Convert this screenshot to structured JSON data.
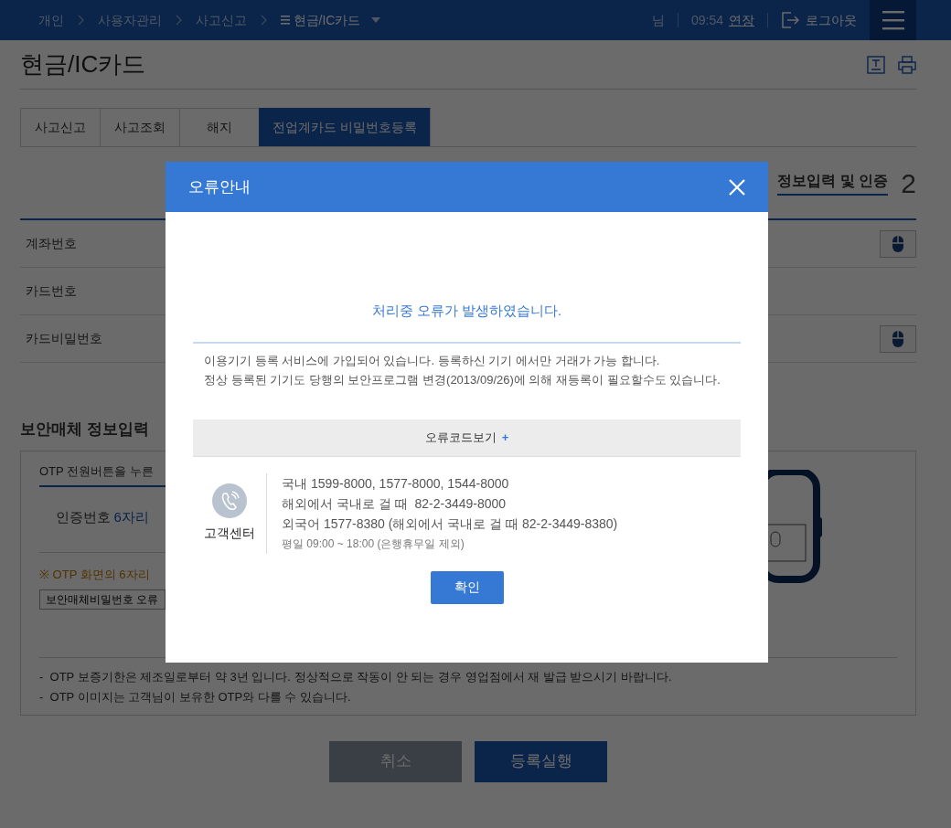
{
  "header": {
    "breadcrumbs": [
      "개인",
      "사용자관리",
      "사고신고"
    ],
    "current_menu": "현금/IC카드",
    "user_suffix": "님",
    "time": "09:54",
    "extend_link": "연장",
    "logout": "로그아웃"
  },
  "page_title": "현금/IC카드",
  "tabs": [
    {
      "label": "사고신고",
      "selected": false
    },
    {
      "label": "사고조회",
      "selected": false
    },
    {
      "label": "해지",
      "selected": false
    },
    {
      "label": "전업계카드 비밀번호등록",
      "selected": true
    }
  ],
  "step": {
    "title": "정보입력 및 인증",
    "number": "2"
  },
  "form_rows": [
    {
      "label": "계좌번호",
      "kind": "mouse-input"
    },
    {
      "label": "카드번호",
      "kind": "plain"
    },
    {
      "label": "카드비밀번호",
      "kind": "mouse-input"
    }
  ],
  "otp_section": {
    "title": "보안매체 정보입력",
    "tab": "OTP 전원버튼을 누른",
    "code_label": "인증번호",
    "code_hint": "6자리",
    "notice": "※ OTP 화면의 6자리",
    "error_button": "보안매체비밀번호 오류",
    "notes": [
      "-  OTP 보증기한은 제조일로부터 약 3년 입니다. 정상적으로 작동이 안 되는 경우 영업점에서 재 발급 받으시기 바랍니다.",
      "-  OTP 이미지는 고객님이 보유한 OTP와 다를 수 있습니다."
    ]
  },
  "buttons": [
    {
      "label": "취소",
      "kind": "secondary"
    },
    {
      "label": "등록실행",
      "kind": "primary"
    }
  ],
  "modal": {
    "title": "오류안내",
    "message": "처리중 오류가 발생하였습니다.",
    "details": [
      "이용기기 등록 서비스에 가입되어 있습니다. 등록하신 기기 에서만 거래가 가능 합니다.",
      "정상 등록된 기기도 당행의 보안프로그램 변경(2013/09/26)에 의해 재등록이 필요할수도 있습니다."
    ],
    "code_toggle": "오류코드보기",
    "code_toggle_icon": "+",
    "contact": {
      "label": "고객센터",
      "lines": [
        "국내 1599-8000, 1577-8000, 1544-8000",
        "해외에서 국내로 걸 때  82-2-3449-8000",
        "외국어 1577-8380 (해외에서 국내로 걸 때 82-2-3449-8380)"
      ],
      "hours": "평일 09:00 ~ 18:00 (은행휴무일 제외)"
    },
    "confirm": "확인"
  }
}
